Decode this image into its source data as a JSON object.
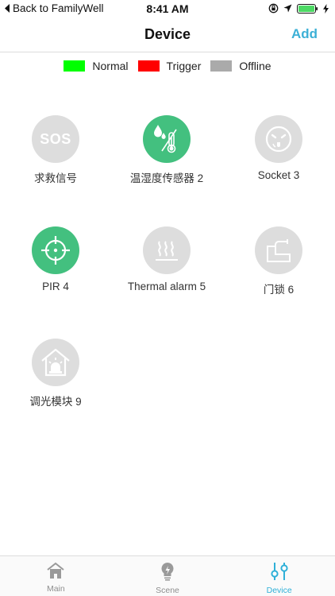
{
  "status_bar": {
    "back_label": "Back to FamilyWell",
    "time": "8:41 AM",
    "battery_color": "#4cd964"
  },
  "nav": {
    "title": "Device",
    "add_label": "Add",
    "accent": "#3cb0d6"
  },
  "legend": [
    {
      "label": "Normal",
      "color": "#00ff00"
    },
    {
      "label": "Trigger",
      "color": "#ff0000"
    },
    {
      "label": "Offline",
      "color": "#aaaaaa"
    }
  ],
  "devices": [
    {
      "label": "求救信号",
      "status": "offline",
      "icon": "sos-icon",
      "icon_text": "SOS"
    },
    {
      "label": "温湿度传感器 2",
      "status": "normal",
      "icon": "temperature-humidity-icon"
    },
    {
      "label": "Socket 3",
      "status": "offline",
      "icon": "socket-icon"
    },
    {
      "label": "PIR 4",
      "status": "normal",
      "icon": "crosshair-icon"
    },
    {
      "label": "Thermal alarm 5",
      "status": "offline",
      "icon": "heat-waves-icon"
    },
    {
      "label": "门锁 6",
      "status": "offline",
      "icon": "door-lock-icon"
    },
    {
      "label": "调光模块 9",
      "status": "offline",
      "icon": "alarm-house-icon"
    }
  ],
  "tabs": [
    {
      "label": "Main",
      "icon": "home-icon",
      "active": false
    },
    {
      "label": "Scene",
      "icon": "lightbulb-icon",
      "active": false
    },
    {
      "label": "Device",
      "icon": "sliders-icon",
      "active": true
    }
  ],
  "colors": {
    "normal": "#43c07f",
    "offline": "#dddddd",
    "active_tab": "#2fb0d8",
    "inactive_tab": "#8e8e8e"
  }
}
